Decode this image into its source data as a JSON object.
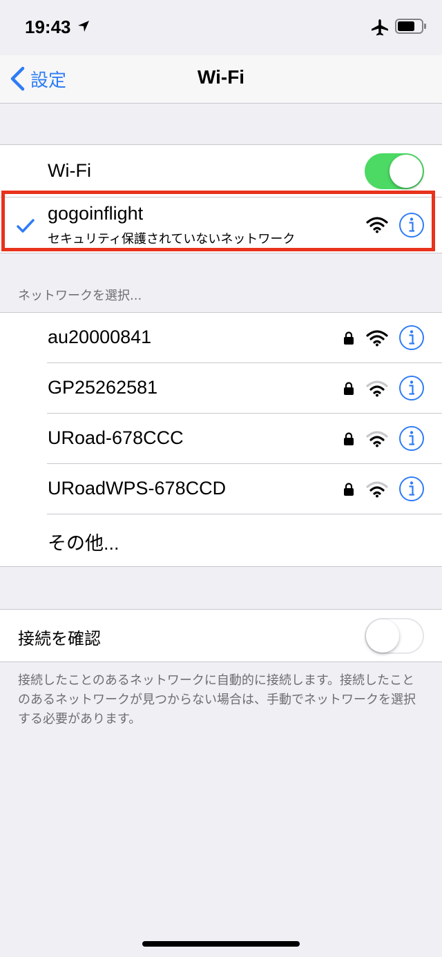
{
  "status_bar": {
    "time": "19:43",
    "icons": [
      "location-arrow-icon",
      "airplane-icon",
      "battery-icon"
    ]
  },
  "nav": {
    "back_label": "設定",
    "title": "Wi-Fi"
  },
  "wifi_group": {
    "wifi_label": "Wi-Fi",
    "wifi_enabled": true,
    "connected": {
      "name": "gogoinflight",
      "subtitle": "セキュリティ保護されていないネットワーク",
      "secured": false
    }
  },
  "networks": {
    "header": "ネットワークを選択...",
    "items": [
      {
        "name": "au20000841",
        "secured": true
      },
      {
        "name": "GP25262581",
        "secured": true
      },
      {
        "name": "URoad-678CCC",
        "secured": true
      },
      {
        "name": "URoadWPS-678CCD",
        "secured": true
      }
    ],
    "other_label": "その他..."
  },
  "ask_to_join": {
    "label": "接続を確認",
    "enabled": false,
    "note": "接続したことのあるネットワークに自動的に接続します。接続したことのあるネットワークが見つからない場合は、手動でネットワークを選択する必要があります。"
  },
  "colors": {
    "accent": "#2e7cf6",
    "toggle_on": "#4cd964",
    "highlight": "#e8321c",
    "background": "#efeff4"
  }
}
